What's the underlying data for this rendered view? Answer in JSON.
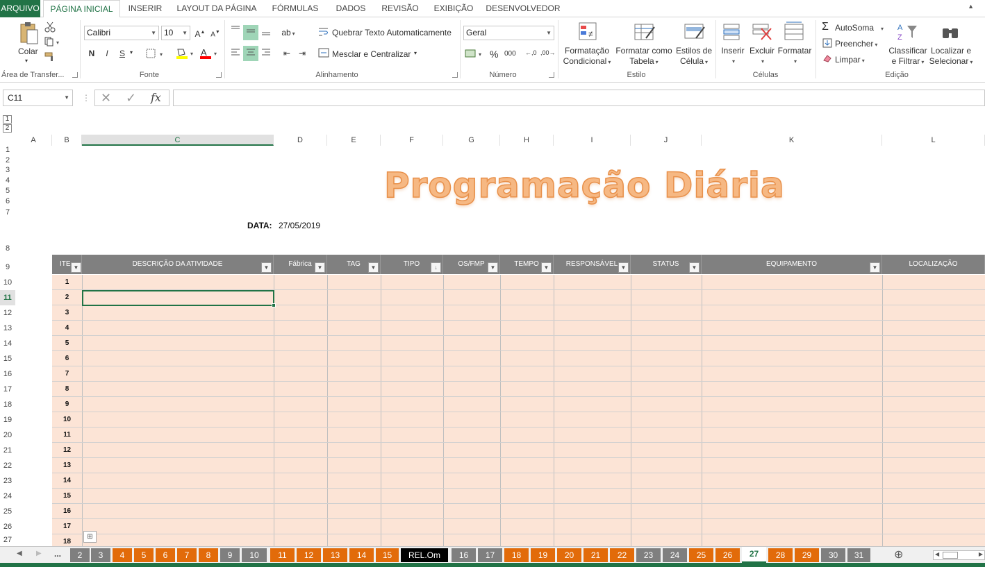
{
  "ribbon_tabs": [
    "ARQUIVO",
    "PÁGINA INICIAL",
    "INSERIR",
    "LAYOUT DA PÁGINA",
    "FÓRMULAS",
    "DADOS",
    "REVISÃO",
    "EXIBIÇÃO",
    "DESENVOLVEDOR"
  ],
  "clipboard": {
    "paste": "Colar",
    "group": "Área de Transfer..."
  },
  "font": {
    "name": "Calibri",
    "size": "10",
    "bold": "N",
    "italic": "I",
    "underline": "S",
    "group": "Fonte"
  },
  "alignment": {
    "wrap": "Quebrar Texto Automaticamente",
    "merge": "Mesclar e Centralizar",
    "group": "Alinhamento"
  },
  "number": {
    "format": "Geral",
    "percent": "%",
    "thousands": "000",
    "group": "Número"
  },
  "styles": {
    "conditional": [
      "Formatação",
      "Condicional"
    ],
    "table": [
      "Formatar como",
      "Tabela"
    ],
    "cell": [
      "Estilos de",
      "Célula"
    ],
    "group": "Estilo"
  },
  "cells": {
    "insert": "Inserir",
    "delete": "Excluir",
    "format": "Formatar",
    "group": "Células"
  },
  "editing": {
    "autosum": "AutoSoma",
    "fill": "Preencher",
    "clear": "Limpar",
    "sort": [
      "Classificar",
      "e Filtrar"
    ],
    "find": [
      "Localizar e",
      "Selecionar"
    ],
    "group": "Edição"
  },
  "formula_bar": {
    "name_box": "C11",
    "fx": "fx",
    "formula": ""
  },
  "outline_levels": [
    "1",
    "2"
  ],
  "columns": [
    "A",
    "B",
    "C",
    "D",
    "E",
    "F",
    "G",
    "H",
    "I",
    "J",
    "K",
    "L"
  ],
  "rows": [
    "1",
    "2",
    "3",
    "4",
    "5",
    "6",
    "7",
    "8",
    "9",
    "10",
    "11",
    "12",
    "13",
    "14",
    "15",
    "16",
    "17",
    "18",
    "19",
    "20",
    "21",
    "22",
    "23",
    "24",
    "25",
    "26",
    "27"
  ],
  "sheet": {
    "title": "Programação Diária",
    "date_label": "DATA:",
    "date_value": "27/05/2019",
    "headers": [
      "ITE",
      "DESCRIÇÃO DA ATIVIDADE",
      "Fábrica",
      "TAG",
      "TIPO",
      "OS/FMP",
      "TEMPO",
      "RESPONSÁVEL",
      "STATUS",
      "EQUIPAMENTO",
      "LOCALIZAÇÃO"
    ],
    "items": [
      "1",
      "2",
      "3",
      "4",
      "5",
      "6",
      "7",
      "8",
      "9",
      "10",
      "11",
      "12",
      "13",
      "14",
      "15",
      "16",
      "17",
      "18"
    ]
  },
  "sheet_tabs": [
    {
      "label": "2",
      "color": "grey"
    },
    {
      "label": "3",
      "color": "grey"
    },
    {
      "label": "4",
      "color": "orange"
    },
    {
      "label": "5",
      "color": "orange"
    },
    {
      "label": "6",
      "color": "orange"
    },
    {
      "label": "7",
      "color": "orange"
    },
    {
      "label": "8",
      "color": "orange"
    },
    {
      "label": "9",
      "color": "grey"
    },
    {
      "label": "10",
      "color": "grey"
    },
    {
      "label": "11",
      "color": "orange"
    },
    {
      "label": "12",
      "color": "orange"
    },
    {
      "label": "13",
      "color": "orange"
    },
    {
      "label": "14",
      "color": "orange"
    },
    {
      "label": "15",
      "color": "orange"
    },
    {
      "label": "REL.Om",
      "color": "black"
    },
    {
      "label": "16",
      "color": "grey"
    },
    {
      "label": "17",
      "color": "grey"
    },
    {
      "label": "18",
      "color": "orange"
    },
    {
      "label": "19",
      "color": "orange"
    },
    {
      "label": "20",
      "color": "orange"
    },
    {
      "label": "21",
      "color": "orange"
    },
    {
      "label": "22",
      "color": "orange"
    },
    {
      "label": "23",
      "color": "grey"
    },
    {
      "label": "24",
      "color": "grey"
    },
    {
      "label": "25",
      "color": "orange"
    },
    {
      "label": "26",
      "color": "orange"
    },
    {
      "label": "27",
      "color": "active"
    },
    {
      "label": "28",
      "color": "orange"
    },
    {
      "label": "29",
      "color": "orange"
    },
    {
      "label": "30",
      "color": "grey"
    },
    {
      "label": "31",
      "color": "grey"
    }
  ],
  "ellipsis": "...",
  "colors": {
    "excel_green": "#217346",
    "header_grey": "#808080",
    "row_fill": "#fce4d6",
    "title_orange": "#f6b883"
  }
}
